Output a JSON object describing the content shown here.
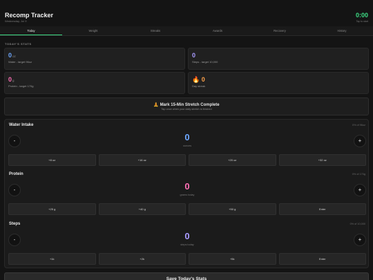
{
  "header": {
    "title": "Recomp Tracker",
    "date": "Wednesday, Jul 9",
    "timer": "0:00",
    "timer_hint": "Tap to start"
  },
  "tabs": [
    "Today",
    "Weight",
    "Streaks",
    "Awards",
    "Recovery",
    "History"
  ],
  "active_tab": "Today",
  "colors": {
    "accent": "#3ddc84",
    "water": "#6ea8ff",
    "protein": "#ff6fb5",
    "steps": "#a99bff",
    "streak": "#ffa24a"
  },
  "stats": {
    "section_label": "TODAY'S STATS",
    "water": {
      "value": "0",
      "unit": "oz",
      "label": "Water - target 96oz"
    },
    "steps": {
      "value": "0",
      "label": "Steps - target 10,000"
    },
    "protein": {
      "value": "0",
      "unit": "g",
      "label": "Protein - target 170g"
    },
    "streak": {
      "icon": "fire-icon",
      "emoji": "🔥",
      "value": "0",
      "label": "Day streak"
    }
  },
  "stretch": {
    "icon": "meditation-icon",
    "emoji": "🧘",
    "title": "Mark 15-Min Stretch Complete",
    "subtitle": "Tap once when your daily stretch is finished"
  },
  "water": {
    "title": "Water Intake",
    "progress": "0% of 96oz",
    "value": "0",
    "sub": "ounces",
    "buttons": [
      "+8 oz",
      "+16 oz",
      "+20 oz",
      "+32 oz"
    ]
  },
  "protein": {
    "title": "Protein",
    "progress": "0% of 170g",
    "value": "0",
    "sub": "grams today",
    "buttons": [
      "+25 g",
      "+40 g",
      "+50 g",
      "Enter"
    ]
  },
  "steps": {
    "title": "Steps",
    "progress": "0% of 10,000",
    "value": "0",
    "sub": "steps today",
    "buttons": [
      "+1k",
      "+2k",
      "+5k",
      "Enter"
    ]
  },
  "controls": {
    "minus": "-",
    "plus": "+"
  },
  "save_label": "Save Today's Stats"
}
